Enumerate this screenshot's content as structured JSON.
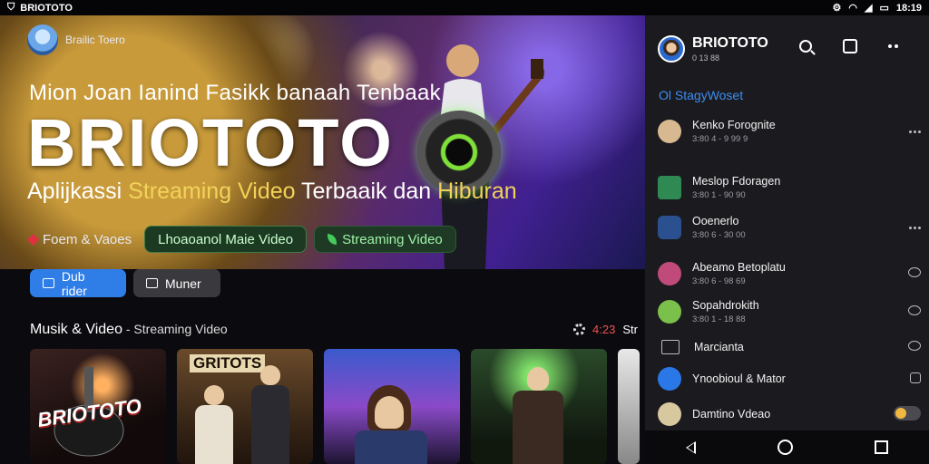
{
  "status": {
    "app_name": "BRIOTOTO",
    "time": "18:19"
  },
  "hero": {
    "channel_name": "Brailic Toero",
    "line1": "Mion Joan Ianind Fasikk banaah Tenbaak",
    "title": "BRIOTOTO",
    "sub_white1": "Aplijkassi ",
    "sub_yellow1": "Streaming Video",
    "sub_white2": " Terbaaik dan ",
    "sub_yellow2": "Hiburan",
    "chip_text": "Foem & Vaoes",
    "chip1": "Lhoaoanol Maie Video",
    "chip2": "Streaming Video"
  },
  "buttons": {
    "primary": "Dub rider",
    "secondary": "Muner"
  },
  "section": {
    "title": "Musik & Video",
    "subtitle": " - Streaming Video",
    "right_num": "4:23",
    "right_text": "Str"
  },
  "cards": [
    {
      "caption": "BRIOTOTO"
    },
    {
      "caption": "GRITOTS"
    },
    {
      "caption": ""
    },
    {
      "caption": ""
    }
  ],
  "panel": {
    "title": "BRIOTOTO",
    "subtitle": "0 13 88",
    "category": "Ol StagyWoset",
    "items": [
      {
        "name": "Kenko Forognite",
        "meta": "3:80 4 - 9 99 9",
        "action": "more",
        "color": "#d8b890"
      },
      {
        "name": "Meslop Fdoragen",
        "meta": "3:80 1 - 90 90",
        "action": "",
        "color": "#2e8a52"
      },
      {
        "name": "Ooenerlo",
        "meta": "3:80 6 - 30 00",
        "action": "more",
        "color": "#2a5090"
      },
      {
        "name": "Abeamo Betoplatu",
        "meta": "3:80 6 - 98 69",
        "action": "bubble",
        "color": "#c04a7a"
      },
      {
        "name": "Sopahdrokith",
        "meta": "3:80 1 - 18 88",
        "action": "bubble",
        "color": "#7ac04a"
      },
      {
        "name": "Marcianta",
        "meta": "",
        "action": "bubble2",
        "color": "transparent"
      },
      {
        "name": "Ynoobioul & Mator",
        "meta": "",
        "action": "square",
        "color": "#2a78e8"
      },
      {
        "name": "Damtino Vdeao",
        "meta": "",
        "action": "toggle",
        "color": "#d8c8a0"
      }
    ]
  },
  "colors": {
    "accent": "#2f7de6",
    "hero_yellow": "#f1d35a",
    "panel_bg": "#1b1b1f"
  }
}
